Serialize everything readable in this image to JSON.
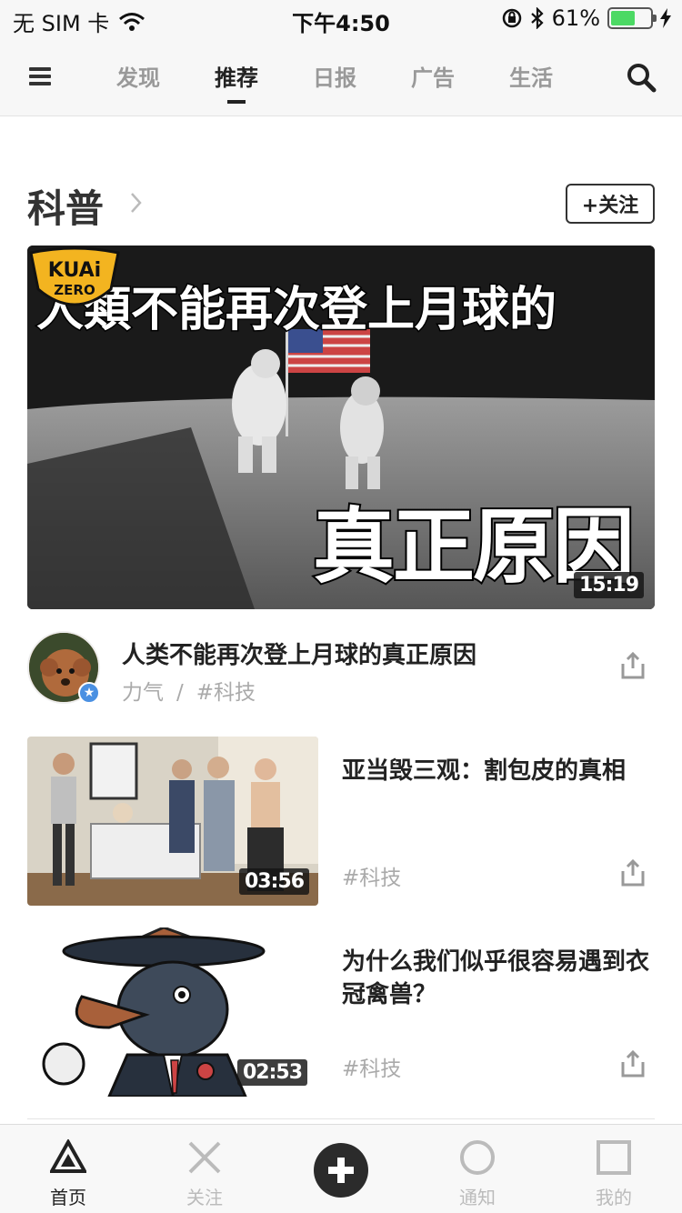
{
  "status_bar": {
    "carrier": "无 SIM 卡",
    "time": "下午4:50",
    "battery_text": "61%",
    "battery_level": 0.61
  },
  "nav": {
    "tabs": [
      {
        "label": "发现"
      },
      {
        "label": "推荐",
        "active": true
      },
      {
        "label": "日报"
      },
      {
        "label": "广告"
      },
      {
        "label": "生活"
      }
    ]
  },
  "section": {
    "title": "科普",
    "follow_label": "+关注"
  },
  "featured": {
    "thumb_title_top": "人類不能再次登上月球的",
    "thumb_title_bottom": "真正原因",
    "logo_text_1": "KUAi",
    "logo_text_2": "ZERO",
    "duration": "15:19",
    "title": "人类不能再次登上月球的真正原因",
    "author": "力气",
    "separator": "/",
    "tag": "#科技"
  },
  "list": [
    {
      "title": "亚当毁三观：割包皮的真相",
      "tag": "#科技",
      "duration": "03:56"
    },
    {
      "title": "为什么我们似乎很容易遇到衣冠禽兽？",
      "tag": "#科技",
      "duration": "02:53"
    }
  ],
  "tab_bar": {
    "items": [
      {
        "label": "首页",
        "icon": "triangle-icon",
        "active": true
      },
      {
        "label": "关注",
        "icon": "x-icon"
      },
      {
        "label": "",
        "icon": "plus-circle-icon"
      },
      {
        "label": "通知",
        "icon": "circle-icon"
      },
      {
        "label": "我的",
        "icon": "square-icon"
      }
    ]
  },
  "colors": {
    "accent": "#222222",
    "muted": "#aaaaaa",
    "battery": "#4cd964",
    "verify": "#4a90e2"
  }
}
